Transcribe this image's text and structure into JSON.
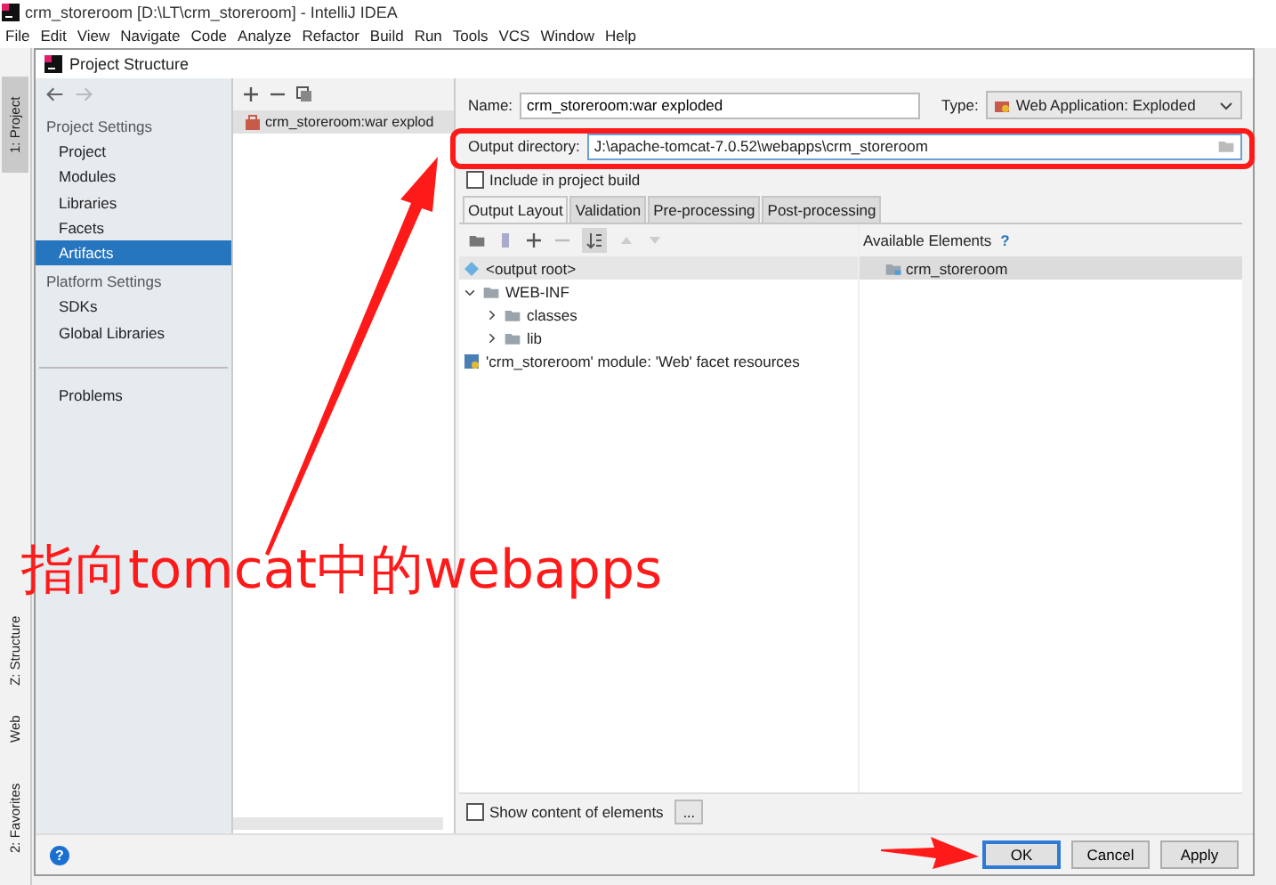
{
  "window": {
    "title": "crm_storeroom [D:\\LT\\crm_storeroom] - IntelliJ IDEA"
  },
  "menu": [
    "File",
    "Edit",
    "View",
    "Navigate",
    "Code",
    "Analyze",
    "Refactor",
    "Build",
    "Run",
    "Tools",
    "VCS",
    "Window",
    "Help"
  ],
  "tool_strip": [
    {
      "label": "1: Project",
      "selected": true
    },
    {
      "label": "Z: Structure",
      "selected": false
    },
    {
      "label": "Web",
      "selected": false
    },
    {
      "label": "2: Favorites",
      "selected": false
    }
  ],
  "dialog": {
    "title": "Project Structure",
    "nav": [
      {
        "kind": "heading",
        "label": "Project Settings"
      },
      {
        "kind": "item",
        "label": "Project",
        "selected": false
      },
      {
        "kind": "item",
        "label": "Modules",
        "selected": false
      },
      {
        "kind": "item",
        "label": "Libraries",
        "selected": false
      },
      {
        "kind": "item",
        "label": "Facets",
        "selected": false
      },
      {
        "kind": "item",
        "label": "Artifacts",
        "selected": true
      },
      {
        "kind": "heading",
        "label": "Platform Settings"
      },
      {
        "kind": "item",
        "label": "SDKs",
        "selected": false
      },
      {
        "kind": "item",
        "label": "Global Libraries",
        "selected": false
      },
      {
        "kind": "divider"
      },
      {
        "kind": "item",
        "label": "Problems",
        "selected": false
      }
    ],
    "artifacts": [
      {
        "label": "crm_storeroom:war explod",
        "selected": true
      }
    ],
    "name_label": "Name:",
    "name_value": "crm_storeroom:war exploded",
    "type_label": "Type:",
    "type_value": "Web Application: Exploded",
    "output_label": "Output directory:",
    "output_value": "J:\\apache-tomcat-7.0.52\\webapps\\crm_storeroom",
    "include_build": {
      "label": "Include in project build",
      "checked": false
    },
    "tabs": [
      {
        "label": "Output Layout",
        "selected": true
      },
      {
        "label": "Validation",
        "selected": false
      },
      {
        "label": "Pre-processing",
        "selected": false
      },
      {
        "label": "Post-processing",
        "selected": false
      }
    ],
    "tree": [
      {
        "kind": "root",
        "label": "<output root>",
        "selected": true
      },
      {
        "kind": "folder",
        "label": "WEB-INF",
        "expanded": true,
        "selected": false,
        "children": [
          {
            "kind": "folder",
            "label": "classes",
            "expanded": false,
            "selected": false
          },
          {
            "kind": "folder",
            "label": "lib",
            "expanded": false,
            "selected": false
          }
        ]
      },
      {
        "kind": "module",
        "label": "'crm_storeroom' module: 'Web' facet resources",
        "selected": false
      }
    ],
    "available_title": "Available Elements",
    "available_help": "?",
    "available": [
      {
        "label": "crm_storeroom",
        "selected": true
      }
    ],
    "show_content": {
      "label": "Show content of elements",
      "checked": false
    },
    "more_button": "...",
    "help": "?",
    "buttons": [
      {
        "label": "OK",
        "focused": true
      },
      {
        "label": "Cancel",
        "focused": false
      },
      {
        "label": "Apply",
        "focused": false
      }
    ]
  },
  "annotation": {
    "text": "指向tomcat中的webapps"
  }
}
